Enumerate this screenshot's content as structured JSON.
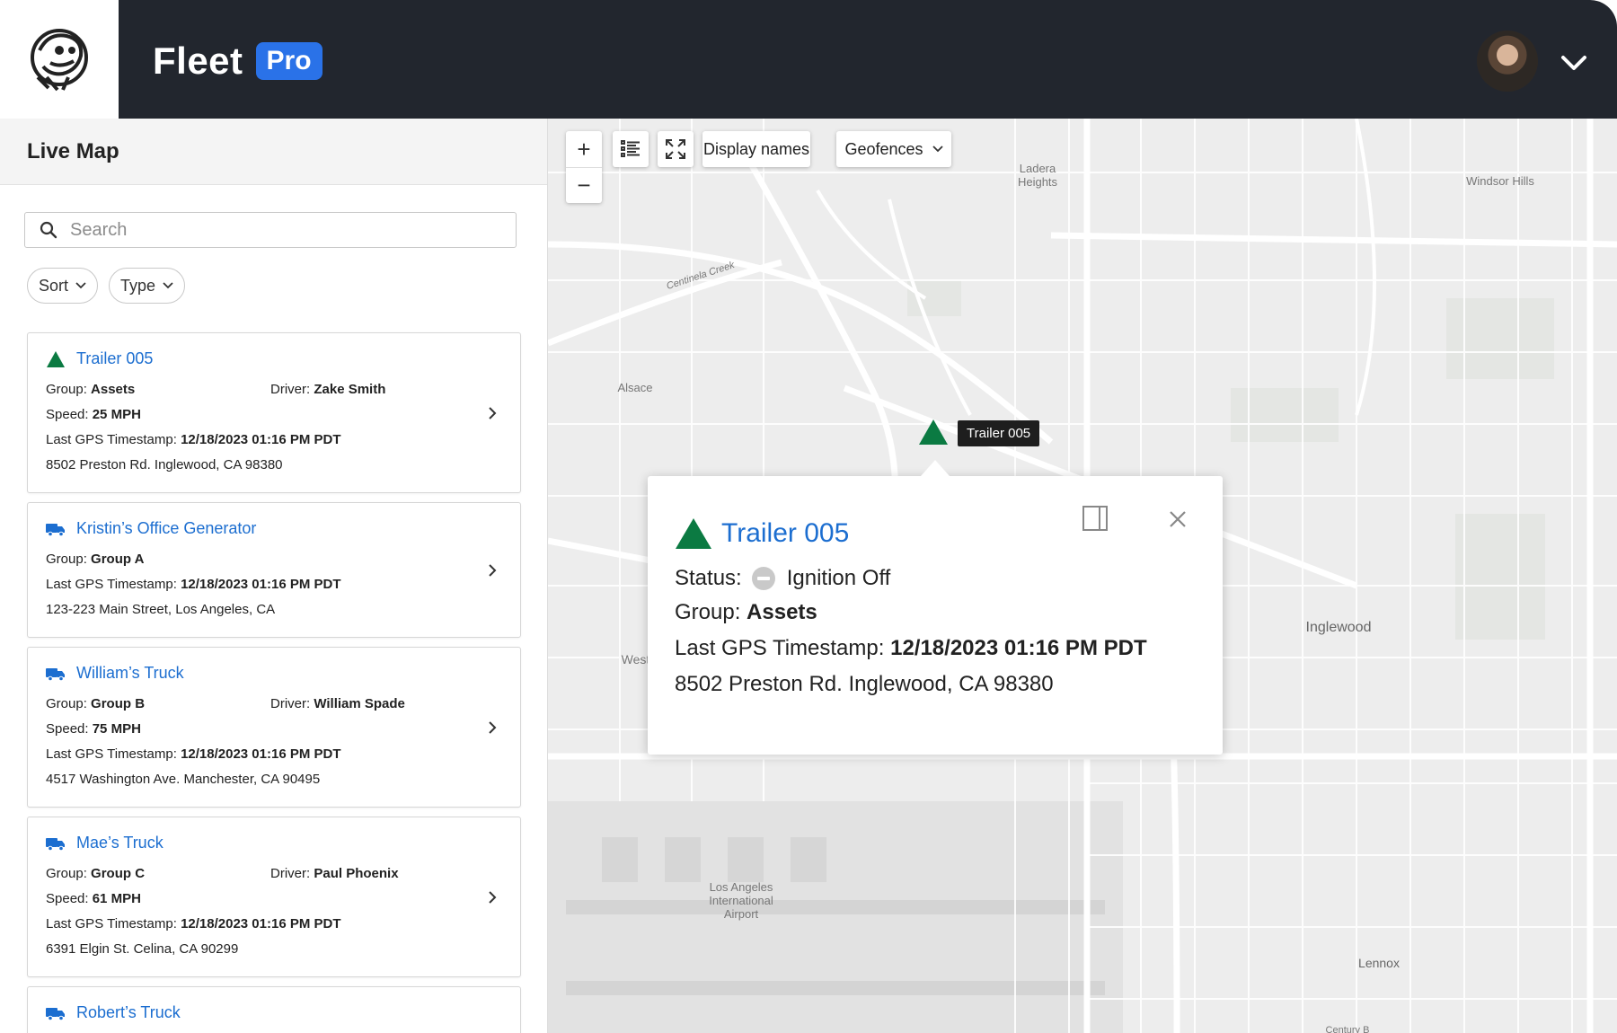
{
  "app": {
    "brand_name": "Fleet",
    "brand_badge": "Pro"
  },
  "sidebar": {
    "title": "Live Map",
    "search_placeholder": "Search",
    "filters": [
      {
        "label": "Sort"
      },
      {
        "label": "Type"
      }
    ],
    "assets": [
      {
        "name": "Trailer 005",
        "icon": "trailer-triangle-icon",
        "group_label": "Group:",
        "group": "Assets",
        "driver_label": "Driver:",
        "driver": "Zake Smith",
        "speed_label": "Speed:",
        "speed": "25 MPH",
        "timestamp_label": "Last GPS Timestamp:",
        "timestamp": "12/18/2023 01:16 PM PDT",
        "address": "8502 Preston Rd. Inglewood, CA 98380"
      },
      {
        "name": "Kristin’s Office Generator",
        "icon": "truck-icon",
        "group_label": "Group:",
        "group": "Group A",
        "timestamp_label": "Last GPS Timestamp:",
        "timestamp": "12/18/2023 01:16 PM PDT",
        "address": "123-223 Main Street, Los Angeles, CA"
      },
      {
        "name": "William’s Truck",
        "icon": "truck-icon",
        "group_label": "Group:",
        "group": "Group B",
        "driver_label": "Driver:",
        "driver": "William Spade",
        "speed_label": "Speed:",
        "speed": "75 MPH",
        "timestamp_label": "Last GPS Timestamp:",
        "timestamp": "12/18/2023 01:16 PM PDT",
        "address": "4517 Washington Ave. Manchester, CA 90495"
      },
      {
        "name": "Mae’s Truck",
        "icon": "truck-icon",
        "group_label": "Group:",
        "group": "Group C",
        "driver_label": "Driver:",
        "driver": "Paul Phoenix",
        "speed_label": "Speed:",
        "speed": "61 MPH",
        "timestamp_label": "Last GPS Timestamp:",
        "timestamp": "12/18/2023 01:16 PM PDT",
        "address": "6391 Elgin St. Celina, CA 90299"
      },
      {
        "name": "Robert’s Truck",
        "icon": "truck-icon"
      }
    ]
  },
  "map": {
    "zoom_in": "+",
    "zoom_out": "−",
    "display_names": "Display names",
    "geofences": "Geofences",
    "places": [
      "Ladera Heights",
      "Windsor Hills",
      "Alsace",
      "Inglewood",
      "Los Angeles International Airport",
      "Lennox",
      "Centinela Creek",
      "Westc",
      "Century B"
    ],
    "marker_label": "Trailer 005",
    "popup": {
      "name": "Trailer 005",
      "status_label": "Status:",
      "status": "Ignition Off",
      "group_label": "Group:",
      "group": "Assets",
      "timestamp_label": "Last GPS Timestamp:",
      "timestamp": "12/18/2023 01:16 PM PDT",
      "address": "8502 Preston Rd. Inglewood, CA 98380"
    }
  },
  "colors": {
    "header_bg": "#22262e",
    "brand_accent": "#2a72e8",
    "link_blue": "#1c6ed0",
    "trailer_green": "#0b7a42"
  }
}
